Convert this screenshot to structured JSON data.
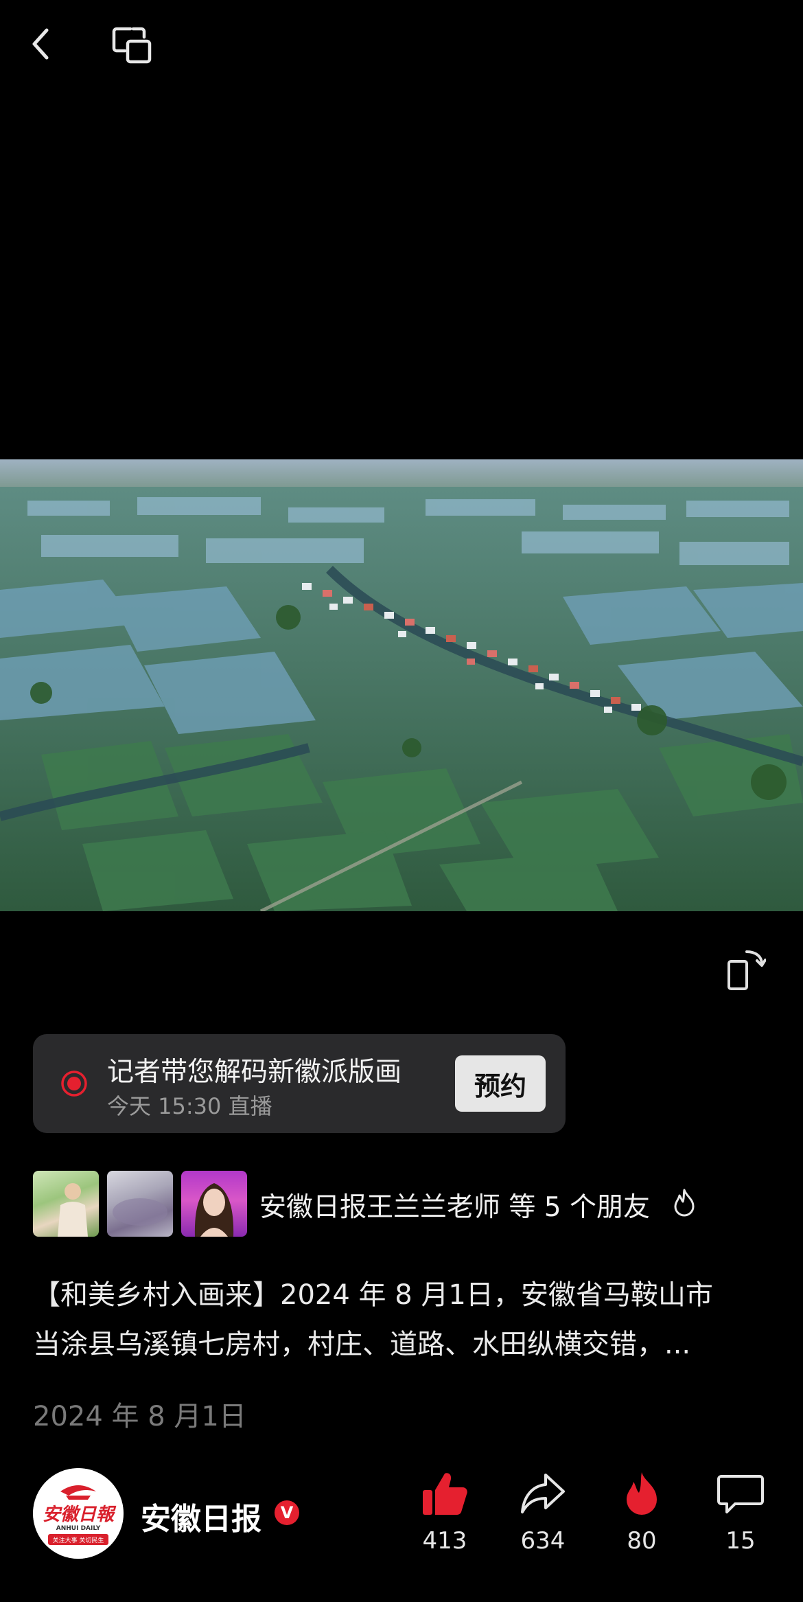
{
  "video": {
    "description": ""
  },
  "live": {
    "title": "记者带您解码新徽派版画",
    "time": "今天 15:30 直播",
    "reserve_label": "预约",
    "accent": "#e5202f"
  },
  "friends": {
    "text": "安徽日报王兰兰老师 等 5 个朋友"
  },
  "post": {
    "line1": "【和美乡村入画来】2024 年 8 月1日，安徽省马鞍山市",
    "line2": "当涂县乌溪镇七房村，村庄、道路、水田纵横交错，...",
    "date": "2024 年 8 月1日"
  },
  "account": {
    "name": "安徽日报",
    "verified_mark": "V",
    "logo_text": "安徽日報",
    "logo_sub": "ANHUI DAILY",
    "logo_tagline": "关注大事 关切民生"
  },
  "actions": {
    "likes": "413",
    "shares": "634",
    "hot": "80",
    "comments": "15",
    "like_color": "#e5202f",
    "hot_color": "#e5202f"
  }
}
